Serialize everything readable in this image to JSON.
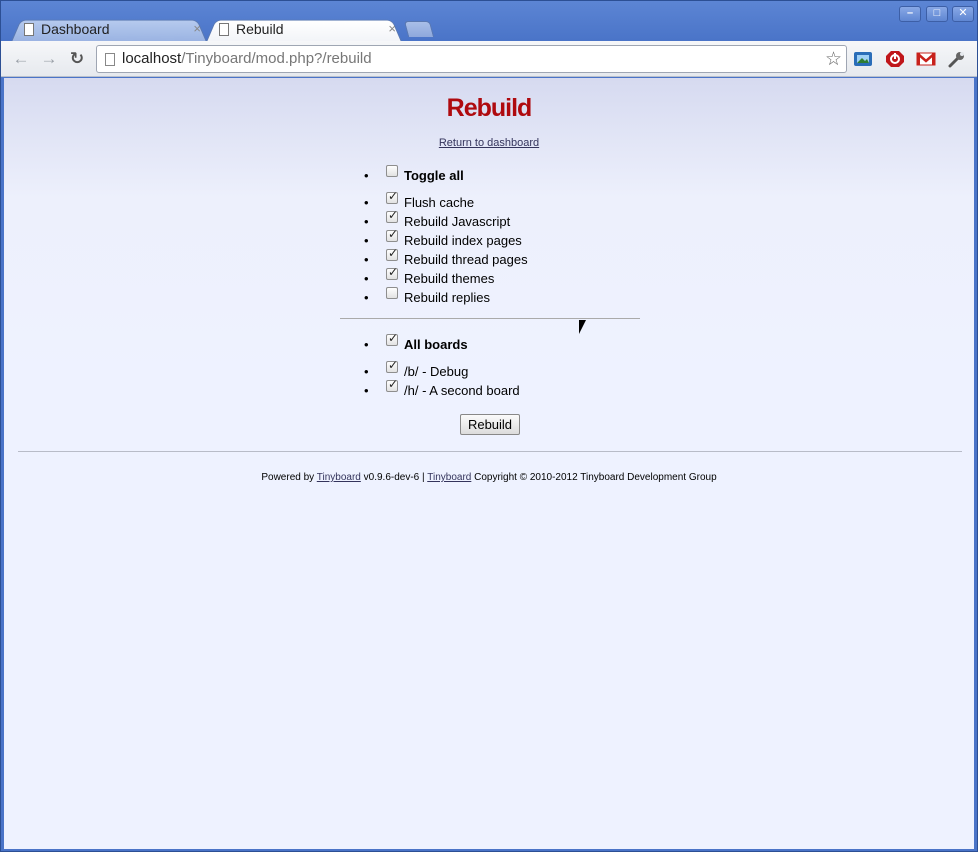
{
  "browser": {
    "tabs": [
      {
        "title": "Dashboard",
        "active": false
      },
      {
        "title": "Rebuild",
        "active": true
      }
    ],
    "tab_close_glyph": "×",
    "window_buttons": {
      "minimize": "–",
      "maximize": "□",
      "close": "✕"
    },
    "url_host": "localhost",
    "url_path": "/Tinyboard/mod.php?/rebuild",
    "nav": {
      "back": "←",
      "forward": "→",
      "reload": "↻",
      "star": "☆"
    },
    "extensions": [
      {
        "name": "photo-extension-icon",
        "color": "#2a6db8"
      },
      {
        "name": "stop-extension-icon",
        "color": "#c0161a"
      },
      {
        "name": "gmail-extension-icon",
        "color": "#c8211b"
      },
      {
        "name": "wrench-menu-icon",
        "color": "#555555"
      }
    ]
  },
  "page": {
    "title": "Rebuild",
    "return_link": "Return to dashboard",
    "bullet": "•",
    "checkmark": "✓",
    "options": [
      {
        "label": "Toggle all",
        "checked": false,
        "bold": true
      },
      {
        "label": "Flush cache",
        "checked": true,
        "bold": false
      },
      {
        "label": "Rebuild Javascript",
        "checked": true,
        "bold": false
      },
      {
        "label": "Rebuild index pages",
        "checked": true,
        "bold": false
      },
      {
        "label": "Rebuild thread pages",
        "checked": true,
        "bold": false
      },
      {
        "label": "Rebuild themes",
        "checked": true,
        "bold": false
      },
      {
        "label": "Rebuild replies",
        "checked": false,
        "bold": false
      }
    ],
    "boards": [
      {
        "label": "All boards",
        "checked": true,
        "bold": true
      },
      {
        "label": "/b/ - Debug",
        "checked": true,
        "bold": false
      },
      {
        "label": "/h/ - A second board",
        "checked": true,
        "bold": false
      }
    ],
    "submit_label": "Rebuild",
    "footer": {
      "powered_by": "Powered by",
      "link1": "Tinyboard",
      "version": "v0.9.6-dev-6 |",
      "link2": "Tinyboard",
      "copyright": "Copyright © 2010-2012 Tinyboard Development Group"
    }
  }
}
